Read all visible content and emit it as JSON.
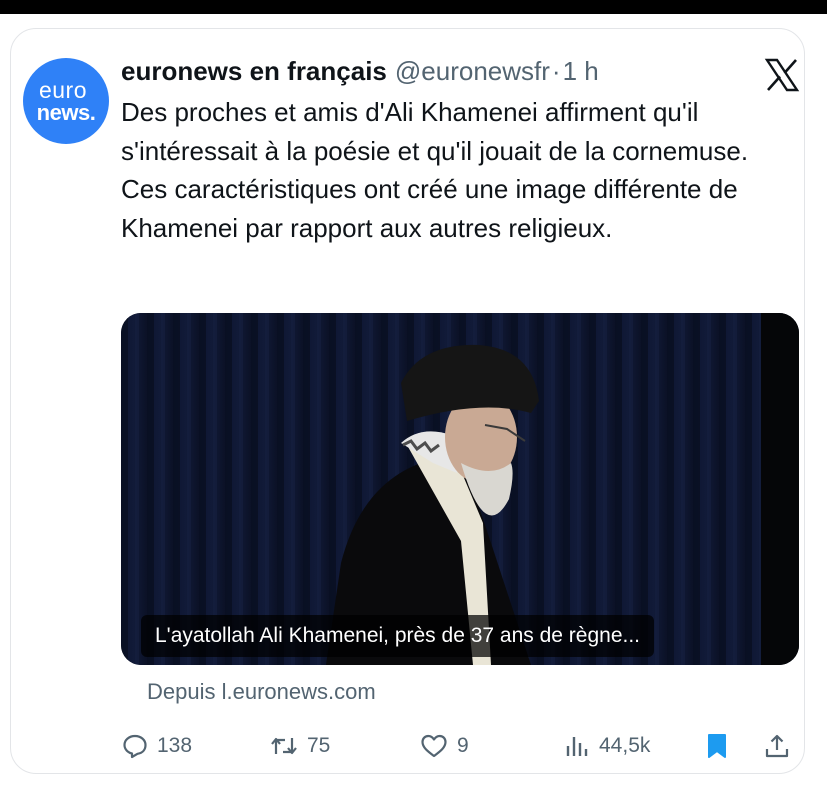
{
  "tweet": {
    "avatar": {
      "line1": "euro",
      "line2": "news.",
      "color": "#2f81f7",
      "icon": "euronews-logo"
    },
    "author_name": "euronews en français",
    "handle": "@euronewsfr",
    "separator": "·",
    "time": "1 h",
    "platform_icon": "x-logo-icon",
    "text": "Des proches et amis d'Ali Khamenei affirment qu'il s'intéressait à la poésie et qu'il jouait de la cornemuse. Ces caractéristiques ont créé une image différente de Khamenei par rapport aux autres religieux.",
    "media_caption": "L'ayatollah Ali Khamenei, près de 37 ans de règne...",
    "source": "Depuis l.euronews.com"
  },
  "actions": {
    "replies": "138",
    "reposts": "75",
    "likes": "9",
    "views": "44,5k",
    "bookmark_color": "#1d9bf0"
  }
}
